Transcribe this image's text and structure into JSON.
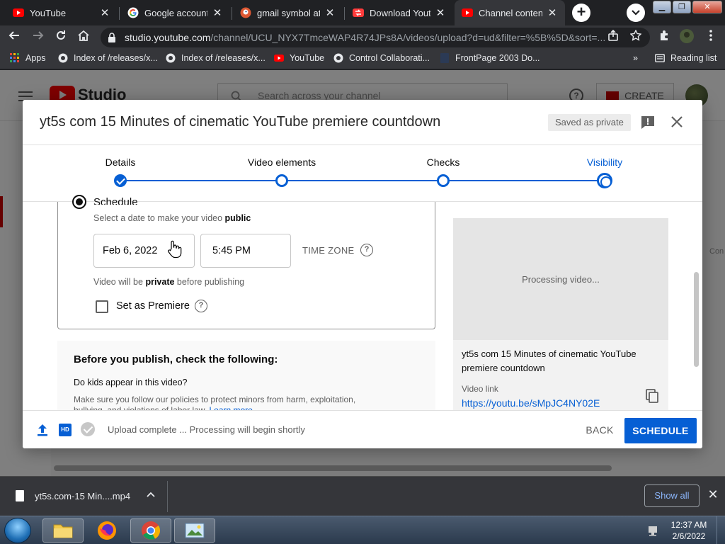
{
  "browser": {
    "tabs": [
      {
        "title": "YouTube",
        "icon": "youtube-icon",
        "active": false
      },
      {
        "title": "Google account n",
        "icon": "google-icon",
        "active": false
      },
      {
        "title": "gmail symbol at D",
        "icon": "duckduckgo-icon",
        "active": false
      },
      {
        "title": "Download Youtub",
        "icon": "download-site-icon",
        "active": false
      },
      {
        "title": "Channel content",
        "icon": "youtube-icon",
        "active": true
      }
    ],
    "address": {
      "host": "studio.youtube.com",
      "path": "/channel/UCU_NYX7TmceWAP4R74JPs8A/videos/upload?d=ud&filter=%5B%5D&sort=..."
    },
    "bookmarks": [
      {
        "label": "Apps",
        "icon": "apps-grid-icon"
      },
      {
        "label": "Index of /releases/x...",
        "icon": "globe-icon"
      },
      {
        "label": "Index of /releases/x...",
        "icon": "globe-icon"
      },
      {
        "label": "YouTube",
        "icon": "youtube-icon"
      },
      {
        "label": "Control Collaborati...",
        "icon": "globe-icon"
      },
      {
        "label": "FrontPage 2003 Do...",
        "icon": "page-icon"
      }
    ],
    "reading_list": "Reading list"
  },
  "studio": {
    "logo_text": "Studio",
    "search_placeholder": "Search across your channel",
    "create_label": "CREATE",
    "right_clip_text": "Con"
  },
  "dialog": {
    "title": "yt5s com 15 Minutes of cinematic YouTube premiere countdown",
    "saved_badge": "Saved as private",
    "steps": [
      {
        "label": "Details",
        "state": "done"
      },
      {
        "label": "Video elements",
        "state": "todo"
      },
      {
        "label": "Checks",
        "state": "todo"
      },
      {
        "label": "Visibility",
        "state": "current"
      }
    ],
    "schedule": {
      "radio_label": "Schedule",
      "hint_prefix": "Select a date to make your video ",
      "hint_bold": "public",
      "date": "Feb 6, 2022",
      "time": "5:45 PM",
      "timezone_label": "TIME ZONE",
      "private_prefix": "Video will be ",
      "private_bold": "private",
      "private_suffix": " before publishing",
      "premiere_label": "Set as Premiere",
      "premiere_checked": false
    },
    "checklist": {
      "title": "Before you publish, check the following:",
      "question": "Do kids appear in this video?",
      "description": "Make sure you follow our policies to protect minors from harm, exploitation, bullying, and violations of labor law.",
      "learn_more": "Learn more"
    },
    "preview": {
      "processing_text": "Processing video...",
      "video_title": "yt5s com 15 Minutes of cinematic YouTube premiere countdown",
      "link_label": "Video link",
      "link_url": "https://youtu.be/sMpJC4NY02E"
    },
    "footer": {
      "status": "Upload complete ... Processing will begin shortly",
      "back_label": "BACK",
      "schedule_label": "SCHEDULE"
    }
  },
  "downloads": {
    "file_name": "yt5s.com-15 Min....mp4",
    "show_all": "Show all"
  },
  "taskbar": {
    "time": "12:37 AM",
    "date": "2/6/2022",
    "apps": [
      "file-explorer-icon",
      "firefox-icon",
      "chrome-icon",
      "photo-viewer-icon"
    ]
  },
  "colors": {
    "accent": "#065fd4",
    "brand_red": "#ff0000",
    "chrome_dark": "#202124",
    "chrome_toolbar": "#35363a"
  }
}
